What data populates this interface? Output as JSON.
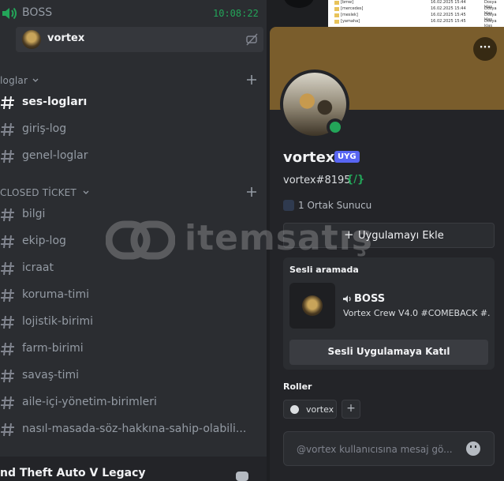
{
  "voice_channel": {
    "name": "BOSS",
    "timer": "10:08:22",
    "connected_user": "vortex"
  },
  "categories": [
    {
      "name": "loglar",
      "channels": [
        "ses-logları",
        "giriş-log",
        "genel-loglar"
      ]
    },
    {
      "name": "CLOSED TİCKET",
      "channels": [
        "bilgi",
        "ekip-log",
        "icraat",
        "koruma-timi",
        "lojistik-birimi",
        "farm-birimi",
        "savaş-timi",
        "aile-içi-yönetim-birimleri",
        "nasıl-masada-söz-hakkına-sahip-olabili..."
      ]
    }
  ],
  "active_channel": "ses-logları",
  "activity_bar": {
    "game": "nd Theft Auto V Legacy"
  },
  "explorer_rows": [
    {
      "name": "[bmw]",
      "date": "16.02.2025 15:44",
      "type": "Dosya klas"
    },
    {
      "name": "[mercedes]",
      "date": "16.02.2025 15:44",
      "type": "Dosya klas"
    },
    {
      "name": "[meslek]",
      "date": "16.02.2025 15:45",
      "type": "Dosya klas"
    },
    {
      "name": "[yamaha]",
      "date": "16.02.2025 15:45",
      "type": "Dosya klas"
    }
  ],
  "profile": {
    "display_name": "vortex",
    "badge": "UYG",
    "handle": "vortex#8195",
    "handle_icon": "{/}",
    "mutual_servers": "1 Ortak Sunucu",
    "add_app_plus": "+",
    "add_app_label": "Uygulamayı Ekle",
    "more_label": "···",
    "voice_section_title": "Sesli aramada",
    "voice_server": "BOSS",
    "voice_server_sub": "Vortex Crew V4.0 #COMEBACK #...",
    "join_label": "Sesli Uygulamaya Katıl",
    "roles_title": "Roller",
    "roles": [
      "vortex"
    ],
    "role_add": "+",
    "message_placeholder": "@vortex kullanıcısına mesaj gö..."
  },
  "watermark": {
    "text": "itemsatış"
  },
  "colors": {
    "accent_green": "#23a559",
    "badge_blue": "#5865f2",
    "banner": "#7a5d2c"
  }
}
